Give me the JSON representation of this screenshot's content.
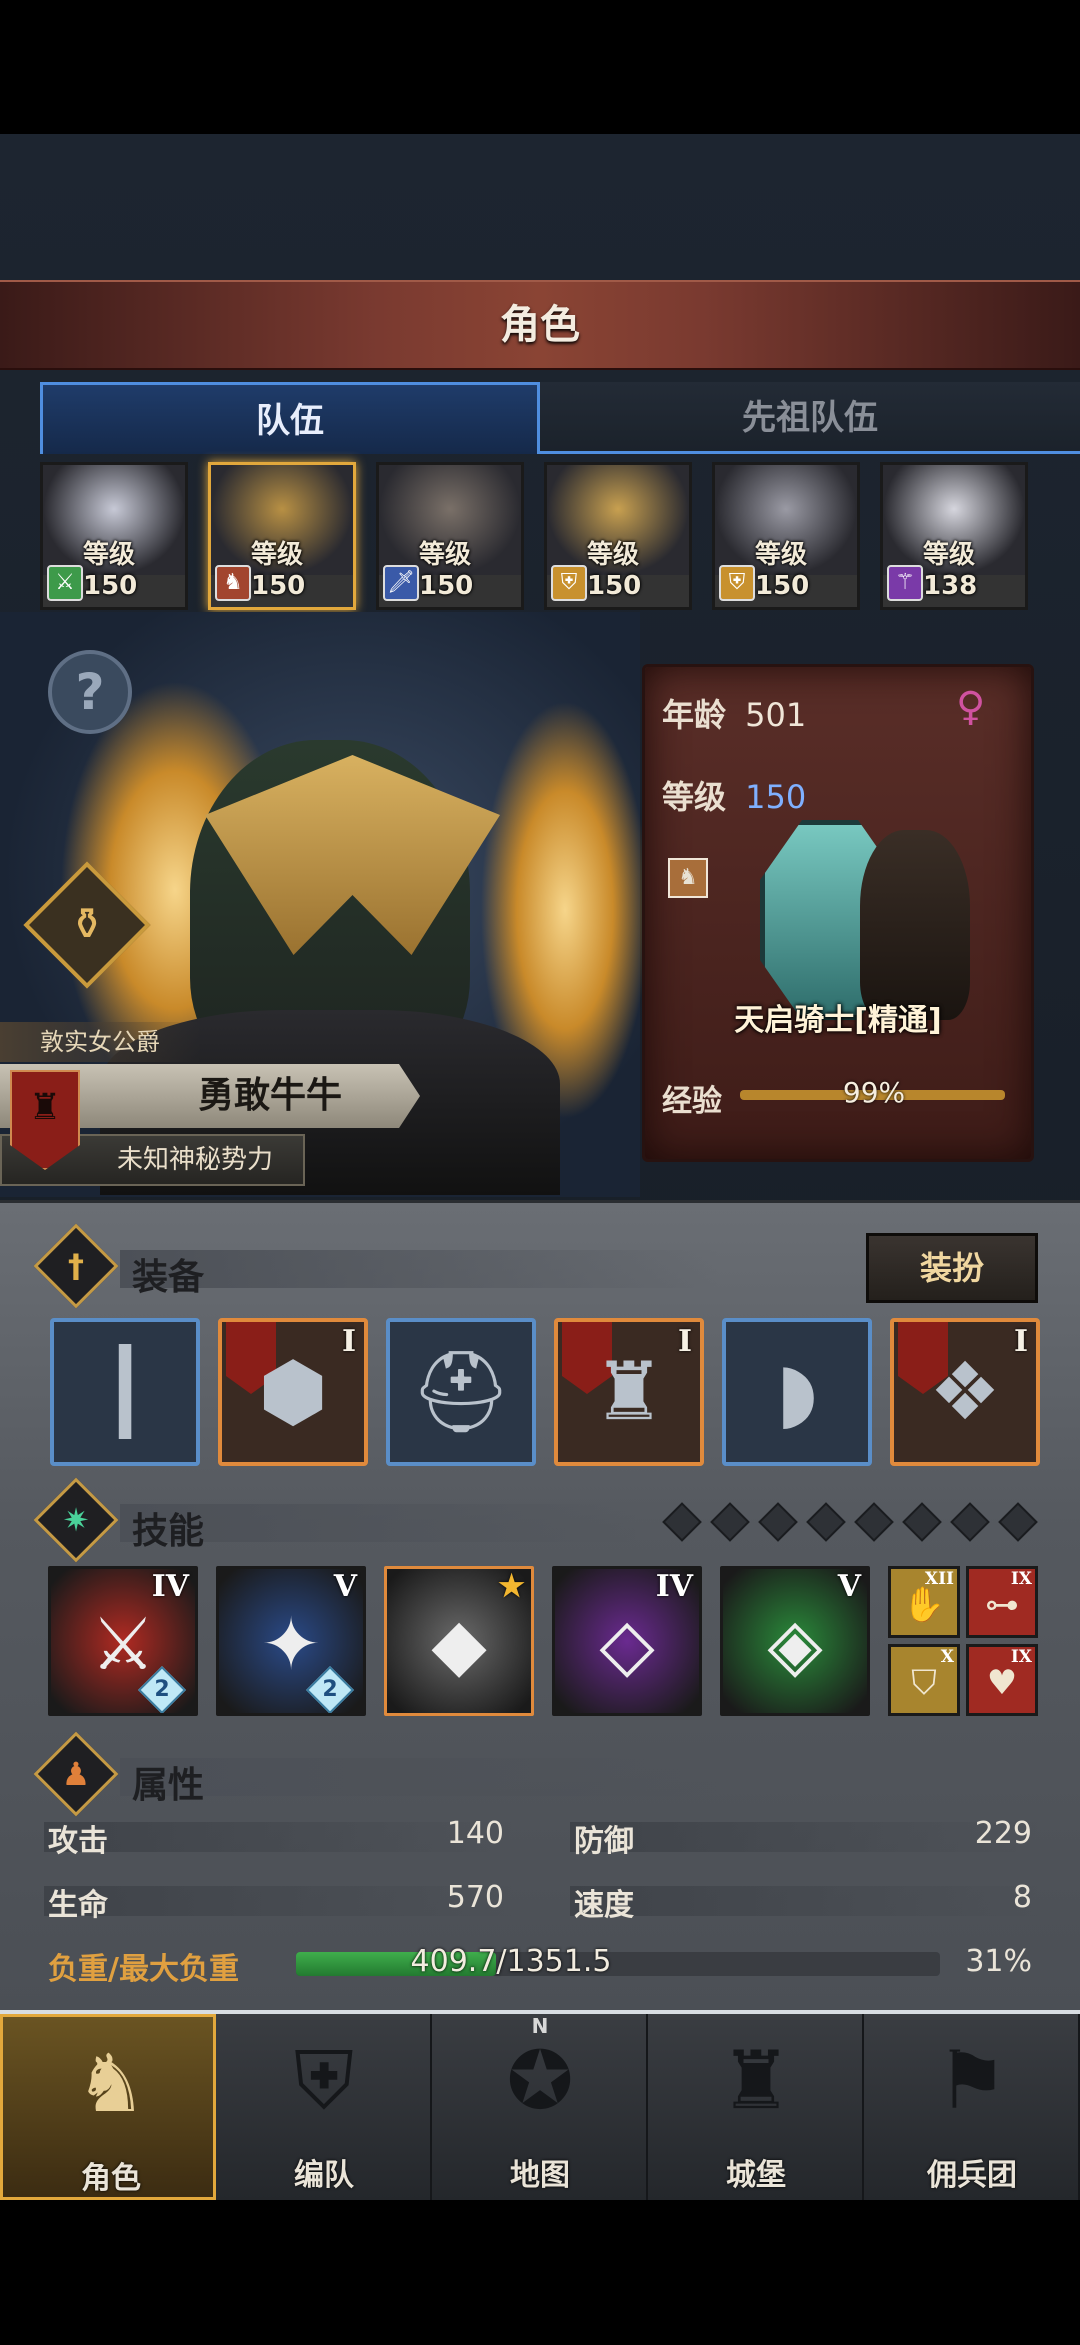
{
  "header": {
    "title": "角色"
  },
  "tabs": [
    {
      "label": "队伍",
      "active": true
    },
    {
      "label": "先祖队伍",
      "active": false
    }
  ],
  "roster": [
    {
      "class_icon": "sword-icon",
      "level_text": "等级150",
      "selected": false,
      "class_color": "#3d9a4a"
    },
    {
      "class_icon": "mount-icon",
      "level_text": "等级150",
      "selected": true,
      "class_color": "#a2452e"
    },
    {
      "class_icon": "dagger-icon",
      "level_text": "等级150",
      "selected": false,
      "class_color": "#3a5aa8"
    },
    {
      "class_icon": "shield-icon",
      "level_text": "等级150",
      "selected": false,
      "class_color": "#c8912e"
    },
    {
      "class_icon": "shield-icon",
      "level_text": "等级150",
      "selected": false,
      "class_color": "#c8912e"
    },
    {
      "class_icon": "staff-icon",
      "level_text": "等级138",
      "selected": false,
      "class_color": "#7a3aa8"
    }
  ],
  "character": {
    "title": "敦实女公爵",
    "name": "勇敢牛牛",
    "faction": "未知神秘势力"
  },
  "info_card": {
    "age_label": "年龄",
    "age": "501",
    "level_label": "等级",
    "level": "150",
    "gender_icon": "female-icon",
    "unit_name": "天启骑士[精通]",
    "exp_label": "经验",
    "exp_text": "99%",
    "exp_fraction": 0.99
  },
  "equipment": {
    "title": "装备",
    "dress_button": "装扮",
    "slots": [
      {
        "icon": "club-icon",
        "tier": "",
        "rarity": "blue"
      },
      {
        "icon": "shield-item-icon",
        "tier": "I",
        "rarity": "orange"
      },
      {
        "icon": "helmet-icon",
        "tier": "",
        "rarity": "blue"
      },
      {
        "icon": "armor-icon",
        "tier": "I",
        "rarity": "orange"
      },
      {
        "icon": "boots-icon",
        "tier": "",
        "rarity": "blue"
      },
      {
        "icon": "knot-charm-icon",
        "tier": "I",
        "rarity": "orange"
      }
    ]
  },
  "skills": {
    "title": "技能",
    "slot_dots": 8,
    "items": [
      {
        "icon": "sword-strike-icon",
        "tier": "IV",
        "badge": "2",
        "color": "#b02a22"
      },
      {
        "icon": "shatter-icon",
        "tier": "V",
        "badge": "2",
        "color": "#2a4a88"
      },
      {
        "icon": "crystal-fist-icon",
        "tier": "★",
        "badge": "",
        "color": "#6a6a6a"
      },
      {
        "icon": "crystal-arm-icon",
        "tier": "IV",
        "badge": "",
        "color": "#6a2a90"
      },
      {
        "icon": "crystal-icon",
        "tier": "V",
        "badge": "",
        "color": "#2a8a3a"
      }
    ],
    "mini": [
      {
        "icon": "gauntlet-icon",
        "tier": "XII",
        "color": "#a8852e"
      },
      {
        "icon": "dumbbell-icon",
        "tier": "IX",
        "color": "#a02a22"
      },
      {
        "icon": "rune-shield-icon",
        "tier": "X",
        "color": "#a8852e"
      },
      {
        "icon": "heart-icon",
        "tier": "IX",
        "color": "#a02a22"
      }
    ]
  },
  "attributes": {
    "title": "属性",
    "attack_label": "攻击",
    "attack": "140",
    "defense_label": "防御",
    "defense": "229",
    "hp_label": "生命",
    "hp": "570",
    "speed_label": "速度",
    "speed": "8",
    "load_label": "负重/最大负重",
    "load_text": "409.7/1351.5",
    "load_percent": "31%",
    "load_fraction": 0.31
  },
  "nav": [
    {
      "label": "角色",
      "icon": "knight-icon",
      "active": true
    },
    {
      "label": "编队",
      "icon": "formation-icon",
      "active": false
    },
    {
      "label": "地图",
      "icon": "compass-icon",
      "active": false
    },
    {
      "label": "城堡",
      "icon": "castle-icon",
      "active": false
    },
    {
      "label": "佣兵团",
      "icon": "mercenary-icon",
      "active": false
    }
  ],
  "compass_letter": "N"
}
